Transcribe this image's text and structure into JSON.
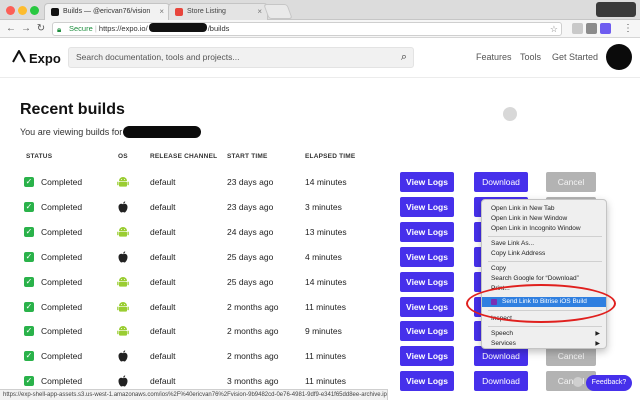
{
  "browser": {
    "tabs": [
      {
        "label": "Builds — @ericvan76/vision",
        "active": true
      },
      {
        "label": "Store Listing",
        "active": false
      }
    ],
    "address": {
      "secure_label": "Secure",
      "url_prefix": "https://expo.io/",
      "url_suffix": "/builds"
    }
  },
  "header": {
    "logo": "Expo",
    "search_placeholder": "Search documentation, tools and projects...",
    "nav": [
      "Features",
      "Tools",
      "Get Started"
    ]
  },
  "page": {
    "title": "Recent builds",
    "subtitle": "You are viewing builds for"
  },
  "table": {
    "columns": [
      "STATUS",
      "OS",
      "RELEASE CHANNEL",
      "START TIME",
      "ELAPSED TIME"
    ],
    "rows": [
      {
        "status": "Completed",
        "os": "android",
        "channel": "default",
        "start": "23 days ago",
        "elapsed": "14 minutes",
        "view": "View Logs",
        "download": "Download",
        "cancel": "Cancel"
      },
      {
        "status": "Completed",
        "os": "ios",
        "channel": "default",
        "start": "23 days ago",
        "elapsed": "3 minutes",
        "view": "View Logs",
        "download": "",
        "cancel": ""
      },
      {
        "status": "Completed",
        "os": "android",
        "channel": "default",
        "start": "24 days ago",
        "elapsed": "13 minutes",
        "view": "View Logs",
        "download": "",
        "cancel": ""
      },
      {
        "status": "Completed",
        "os": "ios",
        "channel": "default",
        "start": "25 days ago",
        "elapsed": "4 minutes",
        "view": "View Logs",
        "download": "",
        "cancel": ""
      },
      {
        "status": "Completed",
        "os": "android",
        "channel": "default",
        "start": "25 days ago",
        "elapsed": "14 minutes",
        "view": "View Logs",
        "download": "",
        "cancel": ""
      },
      {
        "status": "Completed",
        "os": "android",
        "channel": "default",
        "start": "2 months ago",
        "elapsed": "11 minutes",
        "view": "View Logs",
        "download": "",
        "cancel": ""
      },
      {
        "status": "Completed",
        "os": "android",
        "channel": "default",
        "start": "2 months ago",
        "elapsed": "9 minutes",
        "view": "View Logs",
        "download": "",
        "cancel": ""
      },
      {
        "status": "Completed",
        "os": "ios",
        "channel": "default",
        "start": "2 months ago",
        "elapsed": "11 minutes",
        "view": "View Logs",
        "download": "Download",
        "cancel": "Cancel"
      },
      {
        "status": "Completed",
        "os": "ios",
        "channel": "default",
        "start": "3 months ago",
        "elapsed": "11 minutes",
        "view": "View Logs",
        "download": "Download",
        "cancel": "Cancel"
      }
    ]
  },
  "context_menu": {
    "group1": [
      "Open Link in New Tab",
      "Open Link in New Window",
      "Open Link in Incognito Window"
    ],
    "group2": [
      "Save Link As...",
      "Copy Link Address"
    ],
    "group3": [
      "Copy",
      "Search Google for “Download”",
      "Print...",
      "Send Link to Bitrise iOS Build"
    ],
    "group4": [
      "Inspect"
    ],
    "group5": [
      "Speech",
      "Services"
    ]
  },
  "status_url": "https://exp-shell-app-assets.s3.us-west-1.amazonaws.com/ios%2F%40ericvan76%2Fvision-9b9482cd-0e76-4981-9df9-e341f65dd8ee-archive.ipa",
  "feedback_label": "Feedback?",
  "colors": {
    "accent": "#4630eb",
    "success": "#2ab24a",
    "android": "#9acd32",
    "highlight": "#2f7fe0",
    "annotation": "#e0201e"
  }
}
